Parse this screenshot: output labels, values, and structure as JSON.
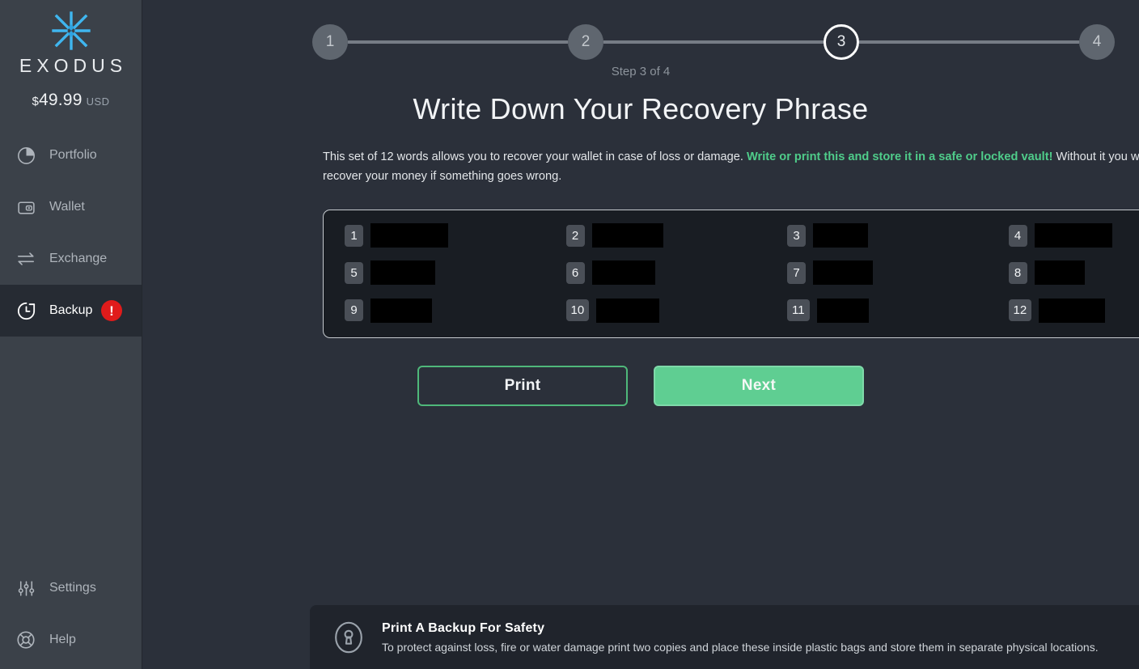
{
  "sidebar": {
    "brand_name": "EXODUS",
    "logo_icon": "exodus-logo-icon",
    "balance": {
      "currency_symbol": "$",
      "amount": "49.99",
      "currency_code": "USD"
    },
    "items": [
      {
        "label": "Portfolio",
        "icon": "pie-chart-icon",
        "active": false
      },
      {
        "label": "Wallet",
        "icon": "wallet-icon",
        "active": false
      },
      {
        "label": "Exchange",
        "icon": "exchange-arrows-icon",
        "active": false
      },
      {
        "label": "Backup",
        "icon": "history-clock-icon",
        "active": true,
        "badge": "!"
      }
    ],
    "bottom_items": [
      {
        "label": "Settings",
        "icon": "sliders-icon"
      },
      {
        "label": "Help",
        "icon": "life-ring-icon"
      }
    ]
  },
  "stepper": {
    "steps": [
      "1",
      "2",
      "3",
      "4"
    ],
    "active_index": 2,
    "caption": "Step 3 of 4"
  },
  "main": {
    "title": "Write Down Your Recovery Phrase",
    "description_part1": "This set of 12 words allows you to recover your wallet in case of loss or damage. ",
    "description_highlight": "Write or print this and store it in a safe or locked vault!",
    "description_part2": " Without it you will not be able to recover your money if something goes wrong."
  },
  "phrase": {
    "word_count": 12,
    "redacted": true,
    "words": [
      {
        "num": "1",
        "redaction_width": 96
      },
      {
        "num": "2",
        "redaction_width": 88
      },
      {
        "num": "3",
        "redaction_width": 68
      },
      {
        "num": "4",
        "redaction_width": 96
      },
      {
        "num": "5",
        "redaction_width": 80
      },
      {
        "num": "6",
        "redaction_width": 78
      },
      {
        "num": "7",
        "redaction_width": 74
      },
      {
        "num": "8",
        "redaction_width": 62
      },
      {
        "num": "9",
        "redaction_width": 76
      },
      {
        "num": "10",
        "redaction_width": 78
      },
      {
        "num": "11",
        "redaction_width": 64
      },
      {
        "num": "12",
        "redaction_width": 82
      }
    ]
  },
  "buttons": {
    "print_label": "Print",
    "next_label": "Next"
  },
  "banner": {
    "icon": "keyhole-lock-icon",
    "title": "Print A Backup For Safety",
    "subtitle": "To protect against loss, fire or water damage print two copies and place these inside plastic bags and store them in separate physical locations."
  },
  "colors": {
    "accent_green": "#4fcc8a",
    "button_green": "#5fce92",
    "alert_red": "#e01b1b",
    "sidebar_bg": "#3b4149",
    "main_bg": "#2b303a",
    "panel_bg": "#191d23"
  }
}
